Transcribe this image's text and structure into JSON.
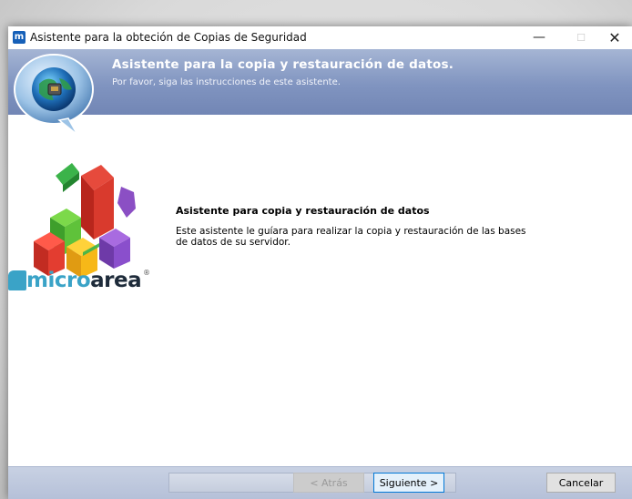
{
  "window": {
    "title": "Asistente para la obteción de Copias de Seguridad",
    "app_icon_letter": "m",
    "controls": {
      "minimize": "—",
      "maximize": "☐",
      "close": "✕"
    }
  },
  "banner": {
    "title": "Asistente para la copia y restauración de datos.",
    "subtitle": "Por favor, siga las instrucciones de este asistente.",
    "icon": "globe-network-bubble-icon"
  },
  "logo": {
    "micro": "micro",
    "area": "area",
    "registered": "®"
  },
  "content": {
    "heading": "Asistente para copia y restauración de datos",
    "body": "Este asistente le guíara para realizar la copia y restauración de las bases de datos de su servidor."
  },
  "buttons": {
    "back": "< Atrás",
    "next": "Siguiente >",
    "cancel": "Cancelar"
  },
  "colors": {
    "banner": "#8094c0",
    "accent": "#0078d7",
    "logo_blue": "#3aa3c7"
  }
}
